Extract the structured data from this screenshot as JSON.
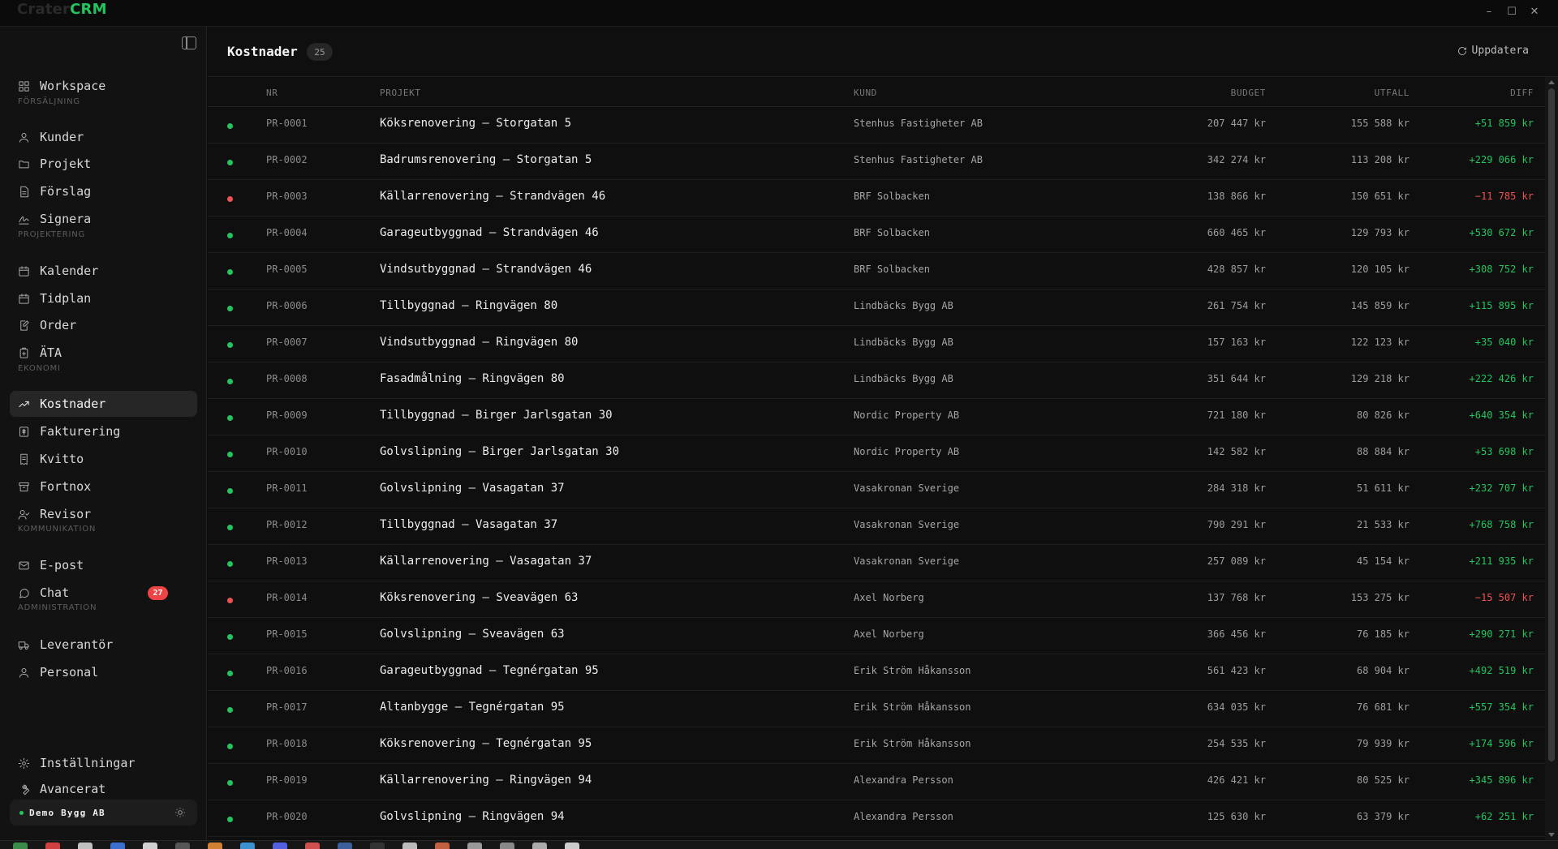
{
  "app": {
    "logo_prefix": "Crater",
    "logo_brand": "CRM",
    "window_controls": [
      "–",
      "☐",
      "✕"
    ]
  },
  "sidebar": {
    "items": [
      {
        "label": "Workspace",
        "icon": "grid-icon"
      },
      {
        "label": "Kunder",
        "icon": "user-icon"
      },
      {
        "label": "Projekt",
        "icon": "folder-icon"
      },
      {
        "label": "Förslag",
        "icon": "document-icon"
      },
      {
        "label": "Signera",
        "icon": "signature-icon"
      },
      {
        "label": "Kalender",
        "icon": "calendar-icon"
      },
      {
        "label": "Tidplan",
        "icon": "calendar-icon"
      },
      {
        "label": "Order",
        "icon": "edit-document-icon"
      },
      {
        "label": "ÄTA",
        "icon": "clipboard-icon"
      },
      {
        "label": "Kostnader",
        "icon": "trend-up-icon",
        "active": true
      },
      {
        "label": "Fakturering",
        "icon": "invoice-icon"
      },
      {
        "label": "Kvitto",
        "icon": "receipt-icon"
      },
      {
        "label": "Fortnox",
        "icon": "archive-icon"
      },
      {
        "label": "Revisor",
        "icon": "user-check-icon"
      },
      {
        "label": "E-post",
        "icon": "mail-icon"
      },
      {
        "label": "Chat",
        "icon": "chat-icon",
        "badge": "27"
      },
      {
        "label": "Leverantör",
        "icon": "truck-icon"
      },
      {
        "label": "Personal",
        "icon": "user-icon"
      },
      {
        "label": "Inställningar",
        "icon": "gear-icon"
      },
      {
        "label": "Avancerat",
        "icon": "wrench-icon"
      }
    ],
    "sections": [
      "FÖRSÄLJNING",
      "PROJEKTERING",
      "EKONOMI",
      "KOMMUNIKATION",
      "ADMINISTRATION"
    ],
    "workspace_name": "Demo Bygg AB"
  },
  "header": {
    "title": "Kostnader",
    "count": "25",
    "refresh_label": "Uppdatera"
  },
  "table": {
    "columns": [
      "NR",
      "PROJEKT",
      "KUND",
      "BUDGET",
      "UTFALL",
      "DIFF"
    ],
    "rows": [
      {
        "nr": "PR-0001",
        "projekt": "Köksrenovering — Storgatan 5",
        "kund": "Stenhus Fastigheter AB",
        "budget": "207 447 kr",
        "utfall": "155 588 kr",
        "diff": "+51 859 kr",
        "status": "positive"
      },
      {
        "nr": "PR-0002",
        "projekt": "Badrumsrenovering — Storgatan 5",
        "kund": "Stenhus Fastigheter AB",
        "budget": "342 274 kr",
        "utfall": "113 208 kr",
        "diff": "+229 066 kr",
        "status": "positive"
      },
      {
        "nr": "PR-0003",
        "projekt": "Källarrenovering — Strandvägen 46",
        "kund": "BRF Solbacken",
        "budget": "138 866 kr",
        "utfall": "150 651 kr",
        "diff": "−11 785 kr",
        "status": "negative"
      },
      {
        "nr": "PR-0004",
        "projekt": "Garageutbyggnad — Strandvägen 46",
        "kund": "BRF Solbacken",
        "budget": "660 465 kr",
        "utfall": "129 793 kr",
        "diff": "+530 672 kr",
        "status": "positive"
      },
      {
        "nr": "PR-0005",
        "projekt": "Vindsutbyggnad — Strandvägen 46",
        "kund": "BRF Solbacken",
        "budget": "428 857 kr",
        "utfall": "120 105 kr",
        "diff": "+308 752 kr",
        "status": "positive"
      },
      {
        "nr": "PR-0006",
        "projekt": "Tillbyggnad — Ringvägen 80",
        "kund": "Lindbäcks Bygg AB",
        "budget": "261 754 kr",
        "utfall": "145 859 kr",
        "diff": "+115 895 kr",
        "status": "positive"
      },
      {
        "nr": "PR-0007",
        "projekt": "Vindsutbyggnad — Ringvägen 80",
        "kund": "Lindbäcks Bygg AB",
        "budget": "157 163 kr",
        "utfall": "122 123 kr",
        "diff": "+35 040 kr",
        "status": "positive"
      },
      {
        "nr": "PR-0008",
        "projekt": "Fasadmålning — Ringvägen 80",
        "kund": "Lindbäcks Bygg AB",
        "budget": "351 644 kr",
        "utfall": "129 218 kr",
        "diff": "+222 426 kr",
        "status": "positive"
      },
      {
        "nr": "PR-0009",
        "projekt": "Tillbyggnad — Birger Jarlsgatan 30",
        "kund": "Nordic Property AB",
        "budget": "721 180 kr",
        "utfall": "80 826 kr",
        "diff": "+640 354 kr",
        "status": "positive"
      },
      {
        "nr": "PR-0010",
        "projekt": "Golvslipning — Birger Jarlsgatan 30",
        "kund": "Nordic Property AB",
        "budget": "142 582 kr",
        "utfall": "88 884 kr",
        "diff": "+53 698 kr",
        "status": "positive"
      },
      {
        "nr": "PR-0011",
        "projekt": "Golvslipning — Vasagatan 37",
        "kund": "Vasakronan Sverige",
        "budget": "284 318 kr",
        "utfall": "51 611 kr",
        "diff": "+232 707 kr",
        "status": "positive"
      },
      {
        "nr": "PR-0012",
        "projekt": "Tillbyggnad — Vasagatan 37",
        "kund": "Vasakronan Sverige",
        "budget": "790 291 kr",
        "utfall": "21 533 kr",
        "diff": "+768 758 kr",
        "status": "positive"
      },
      {
        "nr": "PR-0013",
        "projekt": "Källarrenovering — Vasagatan 37",
        "kund": "Vasakronan Sverige",
        "budget": "257 089 kr",
        "utfall": "45 154 kr",
        "diff": "+211 935 kr",
        "status": "positive"
      },
      {
        "nr": "PR-0014",
        "projekt": "Köksrenovering — Sveavägen 63",
        "kund": "Axel Norberg",
        "budget": "137 768 kr",
        "utfall": "153 275 kr",
        "diff": "−15 507 kr",
        "status": "negative"
      },
      {
        "nr": "PR-0015",
        "projekt": "Golvslipning — Sveavägen 63",
        "kund": "Axel Norberg",
        "budget": "366 456 kr",
        "utfall": "76 185 kr",
        "diff": "+290 271 kr",
        "status": "positive"
      },
      {
        "nr": "PR-0016",
        "projekt": "Garageutbyggnad — Tegnérgatan 95",
        "kund": "Erik Ström Håkansson",
        "budget": "561 423 kr",
        "utfall": "68 904 kr",
        "diff": "+492 519 kr",
        "status": "positive"
      },
      {
        "nr": "PR-0017",
        "projekt": "Altanbygge — Tegnérgatan 95",
        "kund": "Erik Ström Håkansson",
        "budget": "634 035 kr",
        "utfall": "76 681 kr",
        "diff": "+557 354 kr",
        "status": "positive"
      },
      {
        "nr": "PR-0018",
        "projekt": "Köksrenovering — Tegnérgatan 95",
        "kund": "Erik Ström Håkansson",
        "budget": "254 535 kr",
        "utfall": "79 939 kr",
        "diff": "+174 596 kr",
        "status": "positive"
      },
      {
        "nr": "PR-0019",
        "projekt": "Källarrenovering — Ringvägen 94",
        "kund": "Alexandra Persson",
        "budget": "426 421 kr",
        "utfall": "80 525 kr",
        "diff": "+345 896 kr",
        "status": "positive"
      },
      {
        "nr": "PR-0020",
        "projekt": "Golvslipning — Ringvägen 94",
        "kund": "Alexandra Persson",
        "budget": "125 630 kr",
        "utfall": "63 379 kr",
        "diff": "+62 251 kr",
        "status": "positive"
      }
    ]
  },
  "colors": {
    "accent": "#22c55e",
    "positive": "#22c55e",
    "negative": "#f05252",
    "badge": "#ef4444"
  }
}
